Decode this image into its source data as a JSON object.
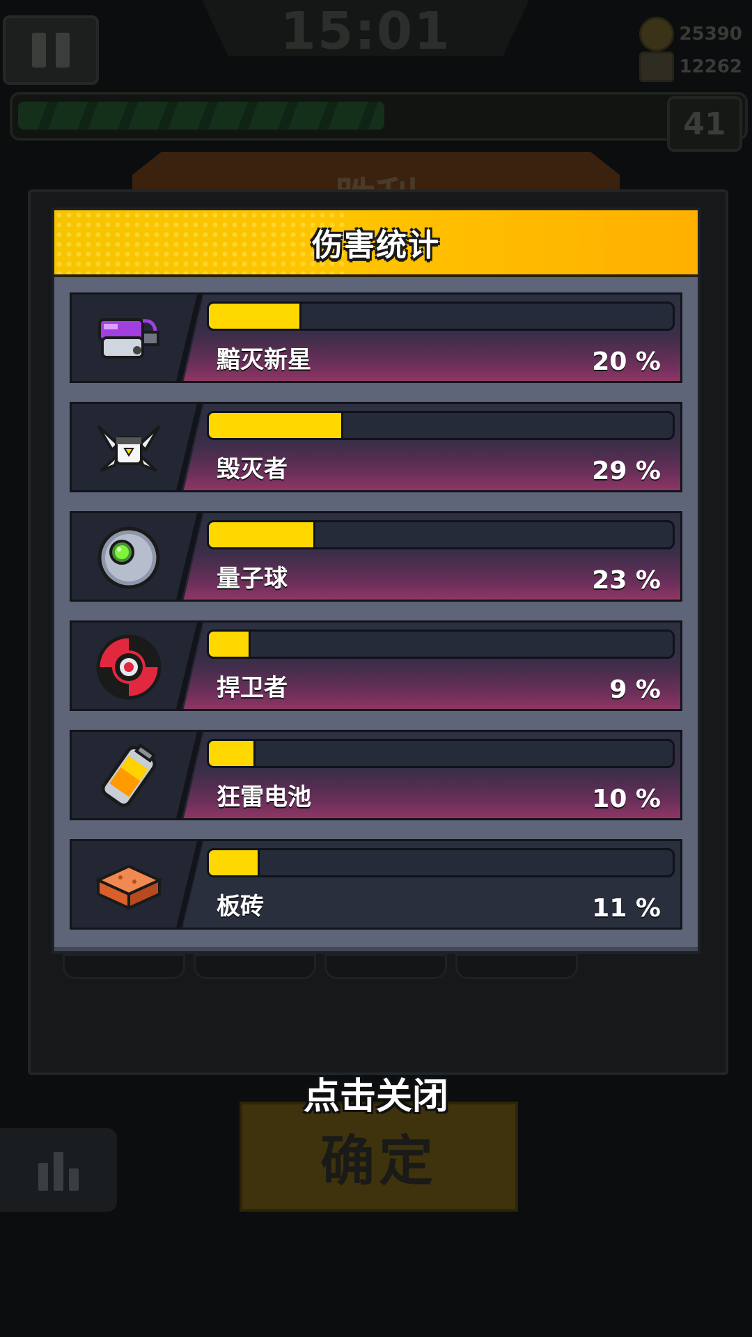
{
  "hud": {
    "timer": "15:01",
    "coins": "25390",
    "gems": "12262",
    "level": "41",
    "xp_progress": 0.5
  },
  "background": {
    "victory_label": "胜利",
    "confirm_label": "确定"
  },
  "modal": {
    "title": "伤害统计",
    "rows": [
      {
        "name": "黯灭新星",
        "percent_label": "20 %",
        "percent": 20,
        "icon": "purple-blaster-icon"
      },
      {
        "name": "毁灭者",
        "percent_label": "29 %",
        "percent": 29,
        "icon": "destroyer-drone-icon"
      },
      {
        "name": "量子球",
        "percent_label": "23 %",
        "percent": 23,
        "icon": "quantum-orb-icon"
      },
      {
        "name": "捍卫者",
        "percent_label": "9 %",
        "percent": 9,
        "icon": "guardian-shuriken-icon"
      },
      {
        "name": "狂雷电池",
        "percent_label": "10 %",
        "percent": 10,
        "icon": "thunder-battery-icon"
      },
      {
        "name": "板砖",
        "percent_label": "11 %",
        "percent": 11,
        "icon": "brick-icon"
      }
    ],
    "bar_max_percent": 100,
    "colors": {
      "bar_fill": "#ffd800",
      "header": "#ffc400",
      "accent": "#c2385f"
    }
  },
  "close_hint": "点击关闭"
}
